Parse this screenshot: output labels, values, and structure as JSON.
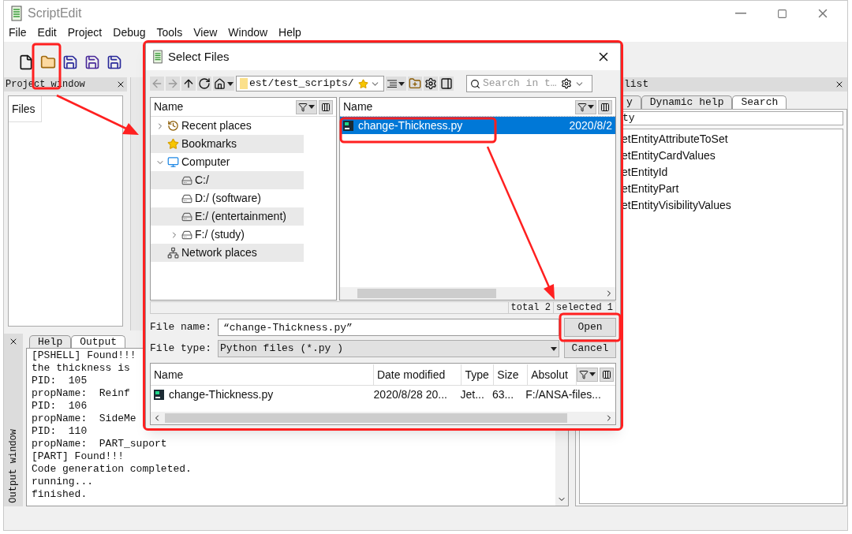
{
  "window": {
    "title": "ScriptEdit"
  },
  "menu": [
    "File",
    "Edit",
    "Project",
    "Debug",
    "Tools",
    "View",
    "Window",
    "Help"
  ],
  "project_window": {
    "title": "Project window",
    "tab": "Files"
  },
  "output_window": {
    "title": "Output window",
    "tabs": [
      {
        "label": "Help",
        "selected": false
      },
      {
        "label": "Output",
        "selected": true
      }
    ],
    "lines": [
      "[PSHELL] Found!!!",
      "the thickness is",
      "PID:  105",
      "propName:  Reinf",
      "PID:  106",
      "propName:  SideMe",
      "PID:  110",
      "propName:  PART_suport",
      "[PART] Found!!!",
      "Code generation completed.",
      "running...",
      "finished."
    ]
  },
  "right_panel": {
    "title": "list",
    "tabs": [
      {
        "label": "y",
        "selected": false
      },
      {
        "label": "Dynamic help",
        "selected": false
      },
      {
        "label": "Search",
        "selected": true
      }
    ],
    "search_value": "ty",
    "results": [
      "etEntityAttributeToSet",
      "etEntityCardValues",
      "etEntityId",
      "etEntityPart",
      "etEntityVisibilityValues"
    ]
  },
  "dialog": {
    "title": "Select Files",
    "path": "est/test_scripts/",
    "search_placeholder": "Search in t…",
    "places_header": "Name",
    "places": [
      {
        "label": "Recent places",
        "kind": "recent",
        "expanded": false
      },
      {
        "label": "Bookmarks",
        "kind": "bookmark"
      },
      {
        "label": "Computer",
        "kind": "computer",
        "expanded": true,
        "children": [
          {
            "label": "C:/",
            "kind": "drive"
          },
          {
            "label": "D:/ (software)",
            "kind": "drive"
          },
          {
            "label": "E:/ (entertainment)",
            "kind": "drive"
          },
          {
            "label": "F:/ (study)",
            "kind": "drive",
            "expanded": false
          }
        ]
      },
      {
        "label": "Network places",
        "kind": "network"
      }
    ],
    "files_header": "Name",
    "files": [
      {
        "name": "change-Thickness.py",
        "date": "2020/8/2",
        "selected": true
      }
    ],
    "status": [
      "total 2",
      "selected 1"
    ],
    "file_name_label": "File name:",
    "file_name_value": "“change-Thickness.py”",
    "file_type_label": "File type:",
    "file_type_value": "Python files (*.py )",
    "buttons": [
      "Open",
      "Cancel"
    ],
    "details_columns": [
      "Name",
      "Date modified",
      "Type",
      "Size",
      "Absolut"
    ],
    "details_rows": [
      [
        "change-Thickness.py",
        "2020/8/28 20...",
        "Jet...",
        "63...",
        "F:/ANSA-files..."
      ]
    ]
  }
}
